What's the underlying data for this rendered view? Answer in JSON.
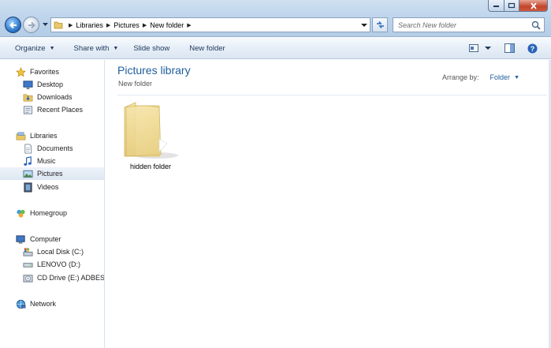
{
  "address": {
    "crumbs": [
      "Libraries",
      "Pictures",
      "New folder"
    ]
  },
  "search": {
    "placeholder": "Search New folder"
  },
  "toolbar": {
    "organize": "Organize",
    "share_with": "Share with",
    "slide_show": "Slide show",
    "new_folder": "New folder"
  },
  "nav": {
    "favorites": "Favorites",
    "desktop": "Desktop",
    "downloads": "Downloads",
    "recent_places": "Recent Places",
    "libraries": "Libraries",
    "documents": "Documents",
    "music": "Music",
    "pictures": "Pictures",
    "videos": "Videos",
    "homegroup": "Homegroup",
    "computer": "Computer",
    "local_disk": "Local Disk (C:)",
    "lenovo": "LENOVO (D:)",
    "cd_drive": "CD Drive (E:) ADBEST",
    "network": "Network"
  },
  "content": {
    "title": "Pictures library",
    "subtitle": "New folder",
    "arrange_label": "Arrange by:",
    "arrange_value": "Folder",
    "items": [
      {
        "name": "hidden folder"
      }
    ]
  },
  "colors": {
    "title_blue": "#1e5e9e",
    "command_text": "#1e395b",
    "folder_yellow": "#f2d88c"
  }
}
